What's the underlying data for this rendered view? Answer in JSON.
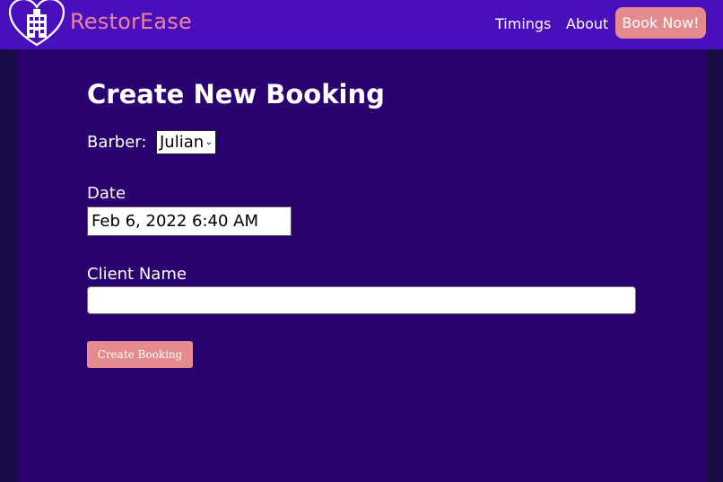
{
  "navbar": {
    "brand": "RestorEase",
    "logo_icon": "hotel-heart-icon",
    "links": [
      {
        "label": "Timings"
      },
      {
        "label": "About"
      }
    ],
    "book_button": "Book Now!"
  },
  "form": {
    "title": "Create New Booking",
    "barber_label": "Barber:",
    "barber_selected": "Julian",
    "date_label": "Date",
    "date_value": "Feb 6, 2022 6:40 AM",
    "client_label": "Client Name",
    "client_value": "",
    "submit_label": "Create Booking"
  },
  "colors": {
    "navbar": "#4a0fbd",
    "panel": "#2a0270",
    "outer": "#1a0a45",
    "accent": "#e58b8d",
    "brand_text": "#e8849a"
  }
}
